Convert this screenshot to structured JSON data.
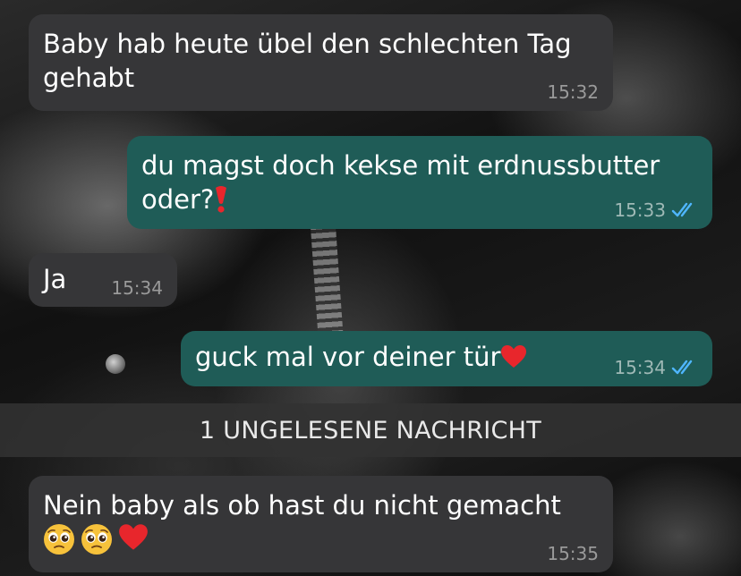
{
  "messages": [
    {
      "text": "Baby hab heute übel den schlechten Tag gehabt",
      "time": "15:32"
    },
    {
      "text": "du magst doch kekse mit erdnussbutter oder?",
      "emoji": "red-exclamation",
      "time": "15:33",
      "status": "read"
    },
    {
      "text": "Ja",
      "time": "15:34"
    },
    {
      "text": "guck mal vor deiner tür",
      "emoji": "red-heart",
      "time": "15:34",
      "status": "read"
    },
    {
      "text": "Nein baby als ob hast du nicht gemacht",
      "emojis": [
        "pleading-face",
        "pleading-face",
        "red-heart"
      ],
      "time": "15:35"
    }
  ],
  "unread_divider": {
    "label": "1 UNGELESENE NACHRICHT"
  },
  "colors": {
    "incoming_bubble": "#363638",
    "outgoing_bubble": "#1f5c57",
    "read_ticks": "#4fb6ff",
    "heart": "#e8262c"
  }
}
